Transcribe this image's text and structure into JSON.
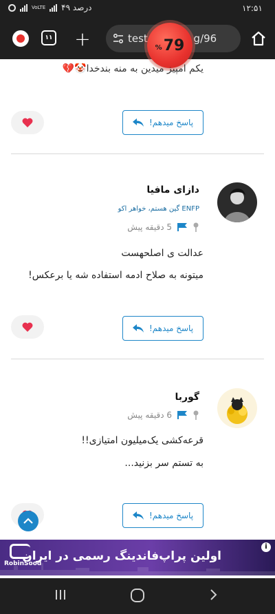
{
  "status_bar": {
    "time": "۱۲:۵۱",
    "battery": "۴۹ درصد",
    "net_label": "VoLTE"
  },
  "browser": {
    "url": "test              g/96",
    "tab_count": "۱۱",
    "badge_value": "79",
    "badge_unit": "%"
  },
  "partial_comment": {
    "text": "یکم امپیز میدین به منه بندخدا🤡💔"
  },
  "reply_label": "پاسخ میدهم!",
  "comments": [
    {
      "username": "دازای مافیا",
      "tag": "ENFP گین هستم، خواهر اکو",
      "time": "5 دقیقه پیش",
      "lines": [
        "عدالت ی اصلحهست",
        "میتونه به صلاح ادمه استفاده شه یا برعکس!"
      ]
    },
    {
      "username": "گوربا",
      "tag": "",
      "time": "6 دقیقه پیش",
      "lines": [
        "قرعه‌کشی یک‌میلیون امتیازی!!",
        "به تستم سر بزنید..."
      ]
    }
  ],
  "ad": {
    "headline": "اولین پراپ‌فاندینگ رسمی در ایران",
    "brand": "RobinSood",
    "info": "i"
  },
  "colors": {
    "accent": "#1d86c8",
    "heart": "#e8314f",
    "badge": "#e8322e",
    "chrome": "#1f1f1f"
  },
  "icons": [
    "alarm-icon",
    "signal-icon",
    "extension-icon",
    "tabs-icon",
    "plus-icon",
    "tune-icon",
    "home-icon",
    "reply-arrow-icon",
    "heart-icon",
    "pin-icon",
    "flag-icon",
    "chevron-up-icon",
    "recents-icon",
    "home-circle-icon",
    "back-icon"
  ]
}
